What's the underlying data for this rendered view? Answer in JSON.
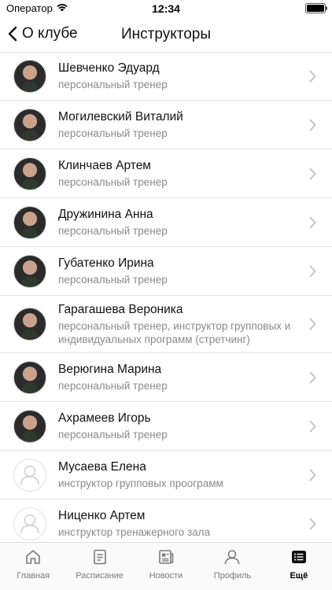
{
  "status_bar": {
    "carrier": "Оператор",
    "time": "12:34"
  },
  "nav": {
    "back_label": "О клубе",
    "title": "Инструкторы"
  },
  "instructors": [
    {
      "name": "Шевченко Эдуард",
      "role": "персональный тренер",
      "avatar": "photo"
    },
    {
      "name": "Могилевский Виталий",
      "role": "персональный тренер",
      "avatar": "photo"
    },
    {
      "name": "Клинчаев Артем",
      "role": "персональный тренер",
      "avatar": "photo"
    },
    {
      "name": "Дружинина Анна",
      "role": "персональный тренер",
      "avatar": "photo"
    },
    {
      "name": "Губатенко Ирина",
      "role": "персональный тренер",
      "avatar": "photo"
    },
    {
      "name": "Гарагашева Вероника",
      "role": "персональный тренер, инструктор групповых и индивидуальных программ (стретчинг)",
      "avatar": "photo"
    },
    {
      "name": "Верюгина Марина",
      "role": "персональный тренер",
      "avatar": "photo"
    },
    {
      "name": "Ахрамеев Игорь",
      "role": "персональный тренер",
      "avatar": "photo"
    },
    {
      "name": "Мусаева Елена",
      "role": "инструктор групповых проограмм",
      "avatar": "placeholder"
    },
    {
      "name": "Ниценко Артем",
      "role": "инструктор тренажерного зала",
      "avatar": "placeholder"
    }
  ],
  "tab_bar": {
    "items": [
      {
        "label": "Главная",
        "icon": "home-icon"
      },
      {
        "label": "Расписание",
        "icon": "schedule-icon"
      },
      {
        "label": "Новости",
        "icon": "news-icon"
      },
      {
        "label": "Профиль",
        "icon": "profile-icon"
      },
      {
        "label": "Ещё",
        "icon": "more-icon",
        "active": true
      }
    ]
  }
}
